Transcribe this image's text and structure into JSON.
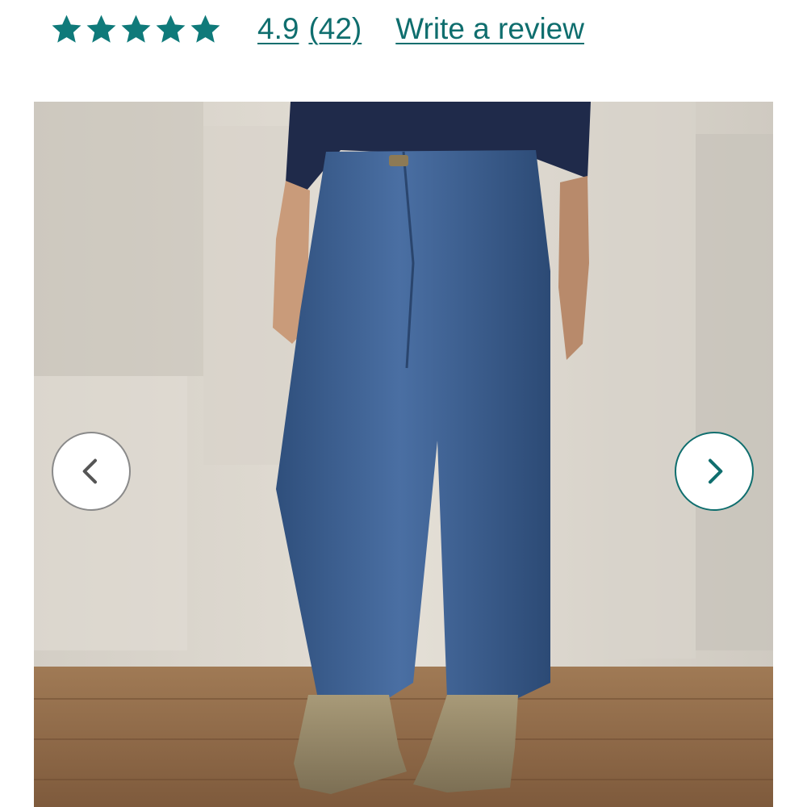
{
  "rating": {
    "star_count": 5,
    "star_color": "#0f7a7a",
    "value": "4.9",
    "count": "(42)",
    "write_review_label": "Write a review",
    "link_color": "#0f6e6e"
  },
  "carousel": {
    "image_description_icon": "product-photo",
    "prev_icon": "chevron-left-icon",
    "next_icon": "chevron-right-icon"
  }
}
